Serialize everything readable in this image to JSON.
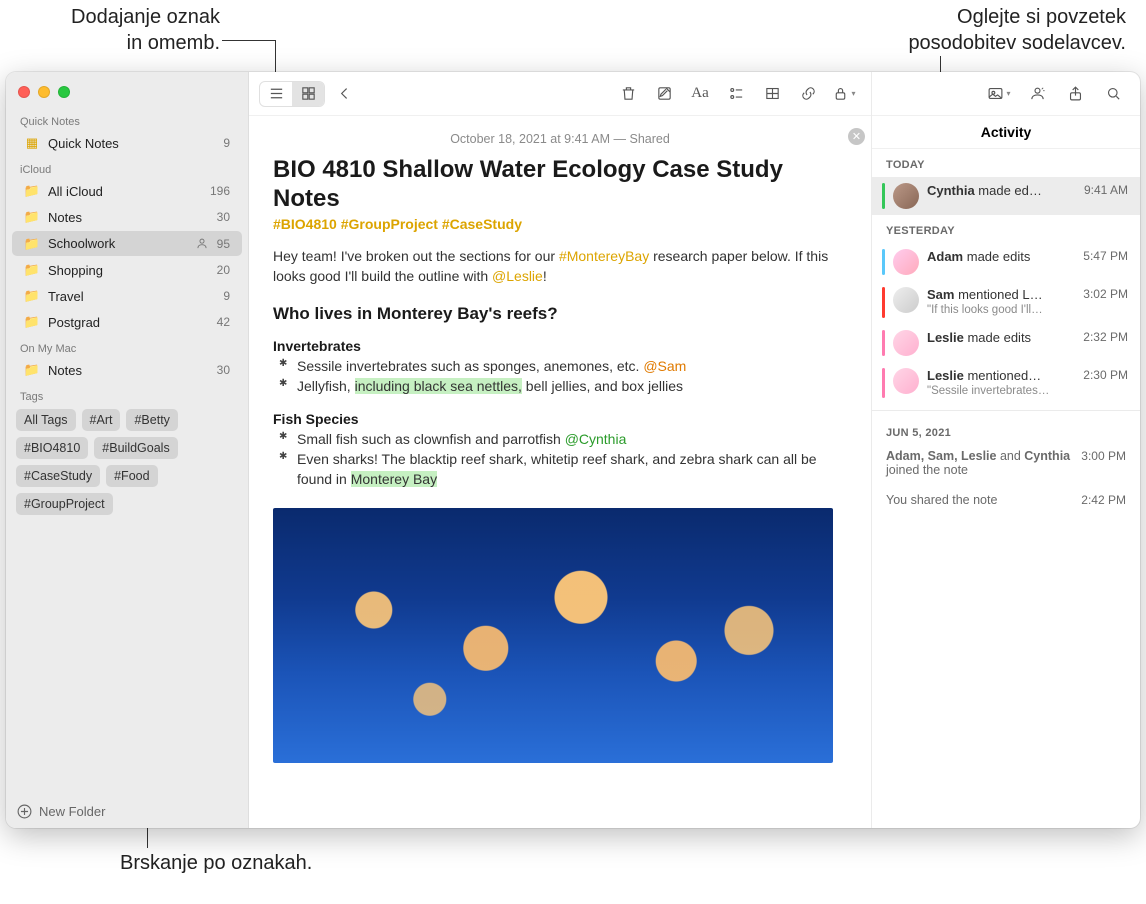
{
  "callouts": {
    "top_left_l1": "Dodajanje oznak",
    "top_left_l2": "in omemb.",
    "top_right_l1": "Oglejte si povzetek",
    "top_right_l2": "posodobitev sodelavcev.",
    "bottom": "Brskanje po oznakah."
  },
  "sidebar": {
    "quick_notes_header": "Quick Notes",
    "quick_notes_item": "Quick Notes",
    "quick_notes_count": "9",
    "icloud_header": "iCloud",
    "items": [
      {
        "label": "All iCloud",
        "count": "196"
      },
      {
        "label": "Notes",
        "count": "30"
      },
      {
        "label": "Schoolwork",
        "count": "95",
        "shared": true,
        "selected": true
      },
      {
        "label": "Shopping",
        "count": "20"
      },
      {
        "label": "Travel",
        "count": "9"
      },
      {
        "label": "Postgrad",
        "count": "42"
      }
    ],
    "onmymac_header": "On My Mac",
    "onmymac_item": {
      "label": "Notes",
      "count": "30"
    },
    "tags_header": "Tags",
    "tags": [
      "All Tags",
      "#Art",
      "#Betty",
      "#BIO4810",
      "#BuildGoals",
      "#CaseStudy",
      "#Food",
      "#GroupProject"
    ],
    "new_folder": "New Folder"
  },
  "note": {
    "meta": "October 18, 2021 at 9:41 AM — Shared",
    "title": "BIO 4810 Shallow Water Ecology Case Study Notes",
    "hashtags": "#BIO4810 #GroupProject #CaseStudy",
    "intro_a": "Hey team! I've broken out the sections for our ",
    "intro_tag": "#MontereyBay",
    "intro_b": " research paper below. If this looks good I'll build the outline with ",
    "intro_mention": "@Leslie",
    "intro_c": "!",
    "h2": "Who lives in Monterey Bay's reefs?",
    "inv_h": "Invertebrates",
    "inv_1a": "Sessile invertebrates such as sponges, anemones, etc. ",
    "inv_1m": "@Sam",
    "inv_2a": "Jellyfish, ",
    "inv_2hl": "including black sea nettles,",
    "inv_2b": " bell jellies, and box jellies",
    "fish_h": "Fish Species",
    "fish_1a": "Small fish such as clownfish and parrotfish ",
    "fish_1m": "@Cynthia",
    "fish_2a": "Even sharks! The blacktip reef shark, whitetip reef shark, and zebra shark can all be found in ",
    "fish_2hl": "Monterey Bay"
  },
  "activity": {
    "title": "Activity",
    "today": "TODAY",
    "row_today": {
      "name": "Cynthia",
      "rest": " made ed…",
      "time": "9:41 AM"
    },
    "yesterday": "YESTERDAY",
    "rows_y": [
      {
        "name": "Adam",
        "rest": " made edits",
        "time": "5:47 PM",
        "edge": "blue"
      },
      {
        "name": "Sam",
        "rest": " mentioned L…",
        "sub": "\"If this looks good I'll…",
        "time": "3:02 PM",
        "edge": "red"
      },
      {
        "name": "Leslie",
        "rest": " made edits",
        "time": "2:32 PM",
        "edge": "pink"
      },
      {
        "name": "Leslie",
        "rest": " mentioned…",
        "sub": "\"Sessile invertebrates…",
        "time": "2:30 PM",
        "edge": "pink"
      }
    ],
    "older_header": "JUN 5, 2021",
    "older_1a": "Adam, Sam, Leslie",
    "older_1b": " and ",
    "older_1c": "Cynthia",
    "older_1d": " joined the note",
    "older_1_time": "3:00 PM",
    "older_2": "You shared the note",
    "older_2_time": "2:42 PM"
  }
}
